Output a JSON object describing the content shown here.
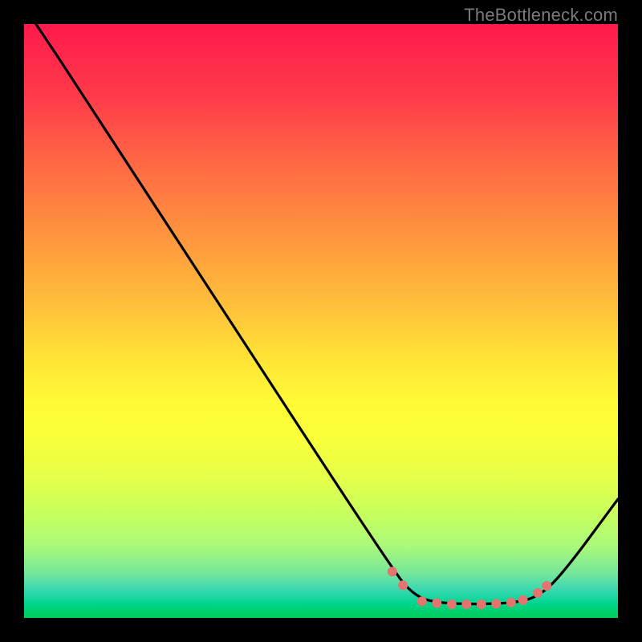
{
  "watermark": "TheBottleneck.com",
  "chart_data": {
    "type": "line",
    "xlim": [
      0,
      100
    ],
    "ylim": [
      0,
      100
    ],
    "background_gradient": {
      "direction": "top-to-bottom",
      "stops": [
        {
          "pos": 0,
          "color": "#ff1a4d"
        },
        {
          "pos": 50,
          "color": "#ffe236"
        },
        {
          "pos": 75,
          "color": "#f8ff3a"
        },
        {
          "pos": 95,
          "color": "#3fd8b0"
        },
        {
          "pos": 100,
          "color": "#00cc5a"
        }
      ]
    },
    "curve": {
      "description": "Bottleneck percentage curve; lower (green) is better",
      "points_xy": [
        [
          2,
          100
        ],
        [
          10,
          88
        ],
        [
          62,
          8
        ],
        [
          66,
          3.5
        ],
        [
          70,
          2.5
        ],
        [
          76,
          2.3
        ],
        [
          82,
          2.5
        ],
        [
          86,
          3.3
        ],
        [
          90,
          6.5
        ],
        [
          100,
          20
        ]
      ]
    },
    "markers": {
      "description": "highlighted data points along valley of curve",
      "color": "#e4746d",
      "radius": 6,
      "points_xy": [
        [
          62.0,
          7.8
        ],
        [
          63.8,
          5.5
        ],
        [
          67.0,
          2.8
        ],
        [
          69.5,
          2.5
        ],
        [
          72.0,
          2.3
        ],
        [
          74.5,
          2.3
        ],
        [
          77.0,
          2.3
        ],
        [
          79.5,
          2.4
        ],
        [
          82.0,
          2.6
        ],
        [
          84.0,
          3.0
        ],
        [
          86.5,
          4.2
        ],
        [
          88.0,
          5.4
        ]
      ]
    }
  }
}
